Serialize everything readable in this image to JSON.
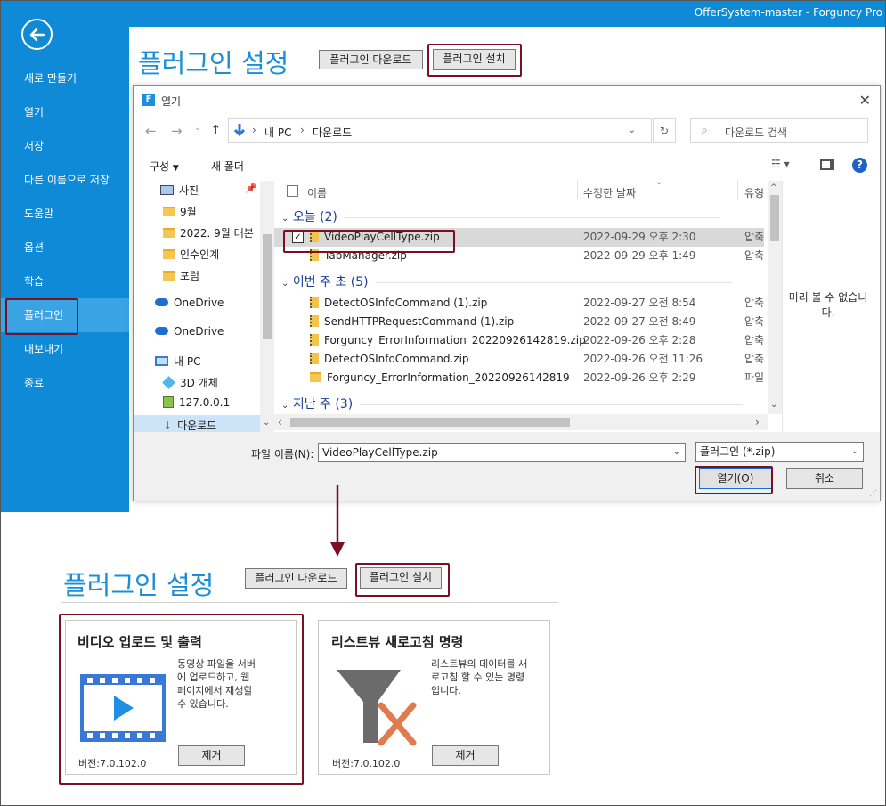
{
  "window": {
    "title": "OfferSystem-master - Forguncy Pro"
  },
  "sidebar": {
    "items": [
      {
        "label": "새로 만들기"
      },
      {
        "label": "열기"
      },
      {
        "label": "저장"
      },
      {
        "label": "다른 이름으로 저장"
      },
      {
        "label": "도움말"
      },
      {
        "label": "옵션"
      },
      {
        "label": "학습"
      },
      {
        "label": "플러그인"
      },
      {
        "label": "내보내기"
      },
      {
        "label": "종료"
      }
    ]
  },
  "plugin_page": {
    "title": "플러그인 설정",
    "download_label": "플러그인 다운로드",
    "install_label": "플러그인 설치"
  },
  "dialog": {
    "title": "열기",
    "breadcrumb": [
      "내 PC",
      "다운로드"
    ],
    "search_placeholder": "다운로드 검색",
    "toolbar": {
      "organize": "구성",
      "new_folder": "새 폴더"
    },
    "tree": [
      {
        "label": "사진",
        "icon": "photo"
      },
      {
        "label": "9월",
        "icon": "folder"
      },
      {
        "label": "2022. 9월 대본",
        "icon": "folder"
      },
      {
        "label": "인수인계",
        "icon": "folder"
      },
      {
        "label": "포럼",
        "icon": "folder"
      },
      {
        "label": "OneDrive",
        "icon": "cloud"
      },
      {
        "label": "OneDrive",
        "icon": "cloud"
      },
      {
        "label": "내 PC",
        "icon": "pc"
      },
      {
        "label": "3D 개체",
        "icon": "cube"
      },
      {
        "label": "127.0.0.1",
        "icon": "network"
      },
      {
        "label": "다운로드",
        "icon": "download"
      }
    ],
    "columns": {
      "name": "이름",
      "date": "수정한 날짜",
      "type": "유형"
    },
    "groups": [
      {
        "label": "오늘 (2)"
      },
      {
        "label": "이번 주 초 (5)"
      },
      {
        "label": "지난 주 (3)"
      }
    ],
    "files": [
      {
        "name": "VideoPlayCellType.zip",
        "date": "2022-09-29 오후 2:30",
        "type": "압축"
      },
      {
        "name": "TabManager.zip",
        "date": "2022-09-29 오후 1:49",
        "type": "압축"
      },
      {
        "name": "DetectOSInfoCommand (1).zip",
        "date": "2022-09-27 오전 8:54",
        "type": "압축"
      },
      {
        "name": "SendHTTPRequestCommand (1).zip",
        "date": "2022-09-27 오전 8:49",
        "type": "압축"
      },
      {
        "name": "Forguncy_ErrorInformation_20220926142819.zip",
        "date": "2022-09-26 오후 2:28",
        "type": "압축"
      },
      {
        "name": "DetectOSInfoCommand.zip",
        "date": "2022-09-26 오전 11:26",
        "type": "압축"
      },
      {
        "name": "Forguncy_ErrorInformation_20220926142819",
        "date": "2022-09-26 오후 2:29",
        "type": "파일"
      }
    ],
    "preview_text": "미리 볼 수 없습니다.",
    "filename_label": "파일 이름(N):",
    "filename_value": "VideoPlayCellType.zip",
    "filter_value": "플러그인 (*.zip)",
    "open_label": "열기(O)",
    "cancel_label": "취소"
  },
  "plugins": [
    {
      "title": "비디오 업로드 및 출력",
      "description": "동영상 파일을 서버에 업로드하고, 웹페이지에서 재생할 수 있습니다.",
      "version": "버전:7.0.102.0",
      "remove_label": "제거"
    },
    {
      "title": "리스트뷰 새로고침 명령",
      "description": "리스트뷰의 데이터를 새로고침 할 수 있는 명령입니다.",
      "version": "버전:7.0.102.0",
      "remove_label": "제거"
    }
  ],
  "colors": {
    "accent": "#0f8ad6",
    "highlight": "#7a1022",
    "title_blue": "#1a8fd8"
  }
}
